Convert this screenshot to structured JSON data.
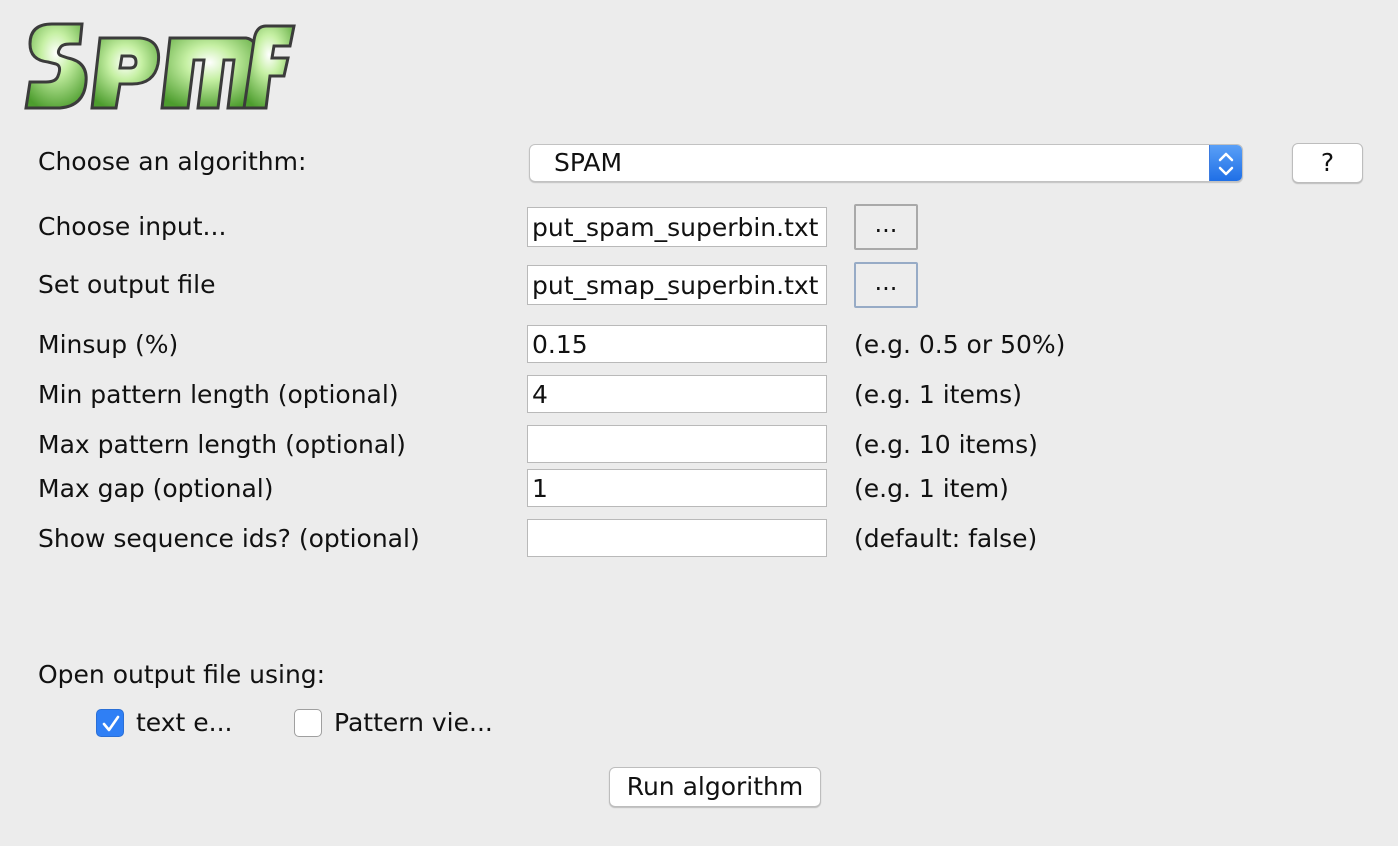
{
  "logo": {
    "text": "SPMF"
  },
  "form": {
    "algorithm": {
      "label": "Choose an algorithm:",
      "selected": "SPAM",
      "help_label": "?"
    },
    "input": {
      "label": "Choose input...",
      "value": "put_spam_superbin.txt",
      "browse_label": "..."
    },
    "output": {
      "label": "Set output file",
      "value": "put_smap_superbin.txt",
      "browse_label": "..."
    },
    "params": [
      {
        "label": "Minsup (%)",
        "value": "0.15",
        "hint": "(e.g. 0.5 or 50%)"
      },
      {
        "label": "Min pattern length (optional)",
        "value": "4",
        "hint": "(e.g. 1 items)"
      },
      {
        "label": "Max pattern length (optional)",
        "value": "",
        "hint": "(e.g. 10 items)"
      },
      {
        "label": "Max gap (optional)",
        "value": "1",
        "hint": "(e.g. 1 item)"
      },
      {
        "label": "Show sequence ids? (optional)",
        "value": "",
        "hint": "(default: false)"
      }
    ]
  },
  "open_output": {
    "label": "Open output file using:",
    "options": [
      {
        "label": "text e...",
        "checked": true
      },
      {
        "label": "Pattern vie...",
        "checked": false
      }
    ]
  },
  "run_button": {
    "label": "Run algorithm"
  },
  "colors": {
    "background": "#ececec",
    "accent": "#2f7ff5",
    "logo_green": "#7fcf5a"
  },
  "icons": {
    "combo_arrows": "up-down-chevron-icon",
    "checkmark": "checkmark-icon"
  }
}
